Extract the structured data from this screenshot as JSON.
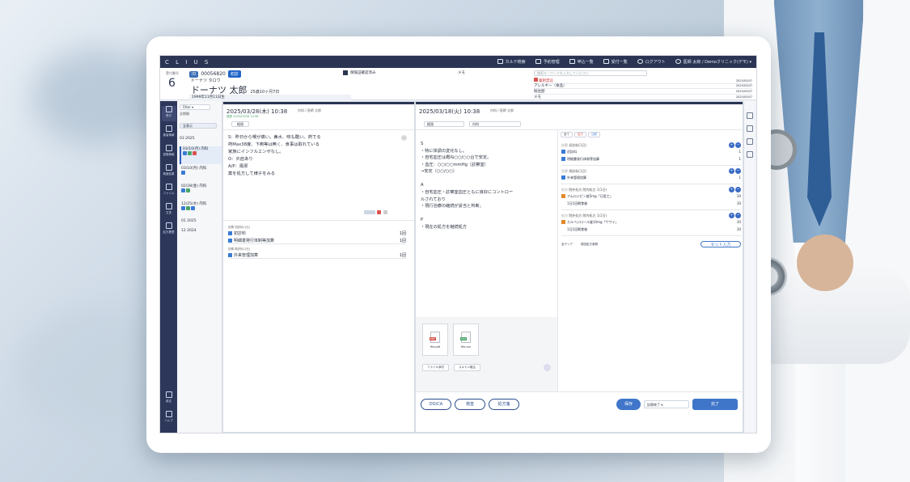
{
  "app": {
    "logo": "C L I U S"
  },
  "topnav": [
    {
      "label": "カルテ検索",
      "icon": "search-record-icon"
    },
    {
      "label": "予約管理",
      "icon": "calendar-icon"
    },
    {
      "label": "申込一覧",
      "icon": "list-icon"
    },
    {
      "label": "受付一覧",
      "icon": "reception-icon"
    },
    {
      "label": "ログアウト",
      "icon": "user-icon"
    },
    {
      "label": "医師 太郎 / Demoクリニック(デモ)",
      "icon": "clock-icon"
    }
  ],
  "patient": {
    "count_label": "受付番号",
    "count": "6",
    "id_label": "ID",
    "id": "00056820",
    "tag": "初診",
    "kana": "ドーナツ タロウ",
    "name": "ドーナツ 太郎",
    "age": "25歳10ヶ月7日",
    "dob": "1999年11月11日生",
    "insurance_check": "保険証確認済み",
    "memo_label": "メモ",
    "alerts_placeholder": "検索キーワードを入力してください",
    "alerts": [
      {
        "label": "薬剤禁忌",
        "date": "2025/03/07"
      },
      {
        "label": "アレルギー（食品）",
        "date": "2025/03/07"
      },
      {
        "label": "既往歴",
        "date": "2025/03/07"
      },
      {
        "label": "メモ",
        "date": "2025/03/07"
      }
    ]
  },
  "leftnav": [
    {
      "label": "受付",
      "icon": "reception-icon"
    },
    {
      "label": "患者情報",
      "icon": "patient-icon"
    },
    {
      "label": "保険情報",
      "icon": "insurance-icon"
    },
    {
      "label": "検査結果",
      "icon": "chart-icon"
    },
    {
      "label": "ファイル",
      "icon": "folder-icon"
    },
    {
      "label": "文書",
      "icon": "document-icon"
    },
    {
      "label": "処方履歴",
      "icon": "rx-icon"
    },
    {
      "label": "設定",
      "icon": "settings-icon"
    },
    {
      "label": "ヘルプ",
      "icon": "help-icon"
    }
  ],
  "history": {
    "filter": "Filter",
    "sub": "全期間",
    "tab": "全表示",
    "entries": [
      {
        "label": "03 2025"
      },
      {
        "label": "03/10(月) 内科",
        "selected": true
      },
      {
        "label": "03/10(月) 内科"
      },
      {
        "label": "02/28(金) 内科"
      },
      {
        "label": "12/25(水) 内科"
      },
      {
        "label": "01 2025"
      },
      {
        "label": "12 2024"
      }
    ]
  },
  "prev_visit": {
    "date": "2025/03/28(木) 10:38",
    "meta": "内科 / 医師 太郎",
    "sub": "登録 2025/03/28 10:38",
    "tab": "経過",
    "soap": [
      "S：昨日から喉が痛い。鼻水、咳も酷い。熱でる",
      "熱Max38度、下痢等は無く、食事は取れている",
      "家族にインフルエンザなし。",
      "",
      "O：炎症あり",
      "",
      "A/P：風邪",
      "薬を処方して様子をみる"
    ],
    "orders": [
      {
        "header": "診察 初診料(1日)",
        "name": "初診料",
        "pts": "1回"
      },
      {
        "header": "",
        "name": "明細書発行体制等加算",
        "pts": "1回"
      },
      {
        "header": "診察 再診料(1日)",
        "name": "外来管理加算",
        "pts": "1回"
      }
    ]
  },
  "current_visit": {
    "date": "2025/03/18(火) 10:38",
    "meta": "内科 / 医師 太郎",
    "tab": "経過",
    "dept": "内科",
    "soap": [
      "S",
      "・特に体調の変化なし。",
      "・自宅血圧は概ね○○/○○台で安定。",
      "・血圧：○○/○○mmHg（診察室）",
      "→安定（○○/○○）",
      "",
      "A",
      "・自宅血圧・診察室血圧ともに良好にコントロー",
      "ルされており",
      "・現行治療の継続が妥当と判断。",
      "",
      "P",
      "・現在の処方を継続処方"
    ],
    "files": [
      {
        "name": "file.pdf",
        "type": "PDF",
        "color": "#d9534f"
      },
      {
        "name": "file.csv",
        "type": "CSV",
        "color": "#4aa56a"
      }
    ],
    "file_btn1": "ファイル添付",
    "file_btn2": "スキャン取込",
    "bottom_buttons": [
      "DO/CA",
      "検査",
      "処方箋"
    ],
    "save": "保存",
    "status": "診察終了",
    "complete": "完了"
  },
  "orders_panel": {
    "tabs": [
      "全て",
      "処方",
      "注射"
    ],
    "blocks": [
      {
        "title": "診察",
        "sub": "初診料(1日)",
        "items": [
          {
            "name": "初診料",
            "qty": "1"
          },
          {
            "name": "明細書発行体制等加算",
            "qty": "1"
          }
        ]
      },
      {
        "title": "診察",
        "sub": "再診料(1日)",
        "items": [
          {
            "name": "外来管理加算",
            "qty": "1"
          }
        ]
      },
      {
        "title": "処方",
        "sub": "院外処方 院内処方 1(1日)",
        "items": [
          {
            "name": "アムロジピン錠5mg「日医工」",
            "qty": "30"
          },
          {
            "name": "1日1回朝食後",
            "qty": "30"
          }
        ]
      },
      {
        "title": "処方",
        "sub": "院外処方 院内処方 1(1日)",
        "items": [
          {
            "name": "カルベジロール錠10mg「サワイ」",
            "qty": "30"
          },
          {
            "name": "1日1回朝食後",
            "qty": "30"
          }
        ]
      }
    ],
    "btn_left": "全クリア",
    "btn_mid": "前回処方参照",
    "btn_right": "セット入力"
  }
}
